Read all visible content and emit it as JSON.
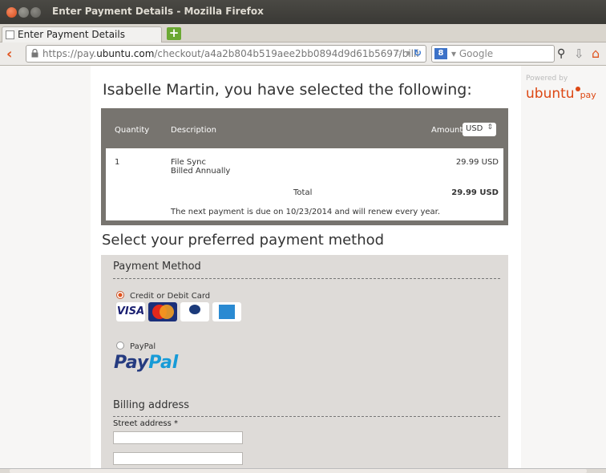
{
  "window": {
    "title": "Enter Payment Details - Mozilla Firefox"
  },
  "tab": {
    "label": "Enter Payment Details",
    "new_tab": "+"
  },
  "nav": {
    "url_prefix": "https://pay.",
    "url_domain": "ubuntu.com",
    "url_path": "/checkout/a4a2b804b519aee2bb0894d9d61b5697/billi",
    "search_engine_letter": "8",
    "search_placeholder": "▾ Google"
  },
  "page": {
    "heading": "Isabelle Martin, you have selected the following:",
    "summary": {
      "headers": {
        "quantity": "Quantity",
        "description": "Description",
        "amount": "Amount"
      },
      "currency": "USD",
      "row": {
        "quantity": "1",
        "description": "File Sync",
        "description2": "Billed Annually",
        "amount": "29.99 USD"
      },
      "total_label": "Total",
      "total_amount": "29.99 USD",
      "renewal_note": "The next payment is due on 10/23/2014 and will renew every year."
    },
    "payment_heading": "Select your preferred payment method",
    "payment_method_title": "Payment Method",
    "options": {
      "card": "Credit or Debit Card",
      "paypal": "PayPal"
    },
    "cards": {
      "visa": "VISA"
    },
    "paypal_logo": {
      "pay": "Pay",
      "pal": "Pal"
    },
    "billing_title": "Billing address",
    "street_label": "Street address *"
  },
  "sidebar": {
    "powered_by": "Powered by",
    "brand": "ubuntu",
    "brand_suffix": "pay"
  },
  "colors": {
    "accent": "#dd4814",
    "summary_bg": "#77746f",
    "panel_bg": "#dedbd8"
  }
}
